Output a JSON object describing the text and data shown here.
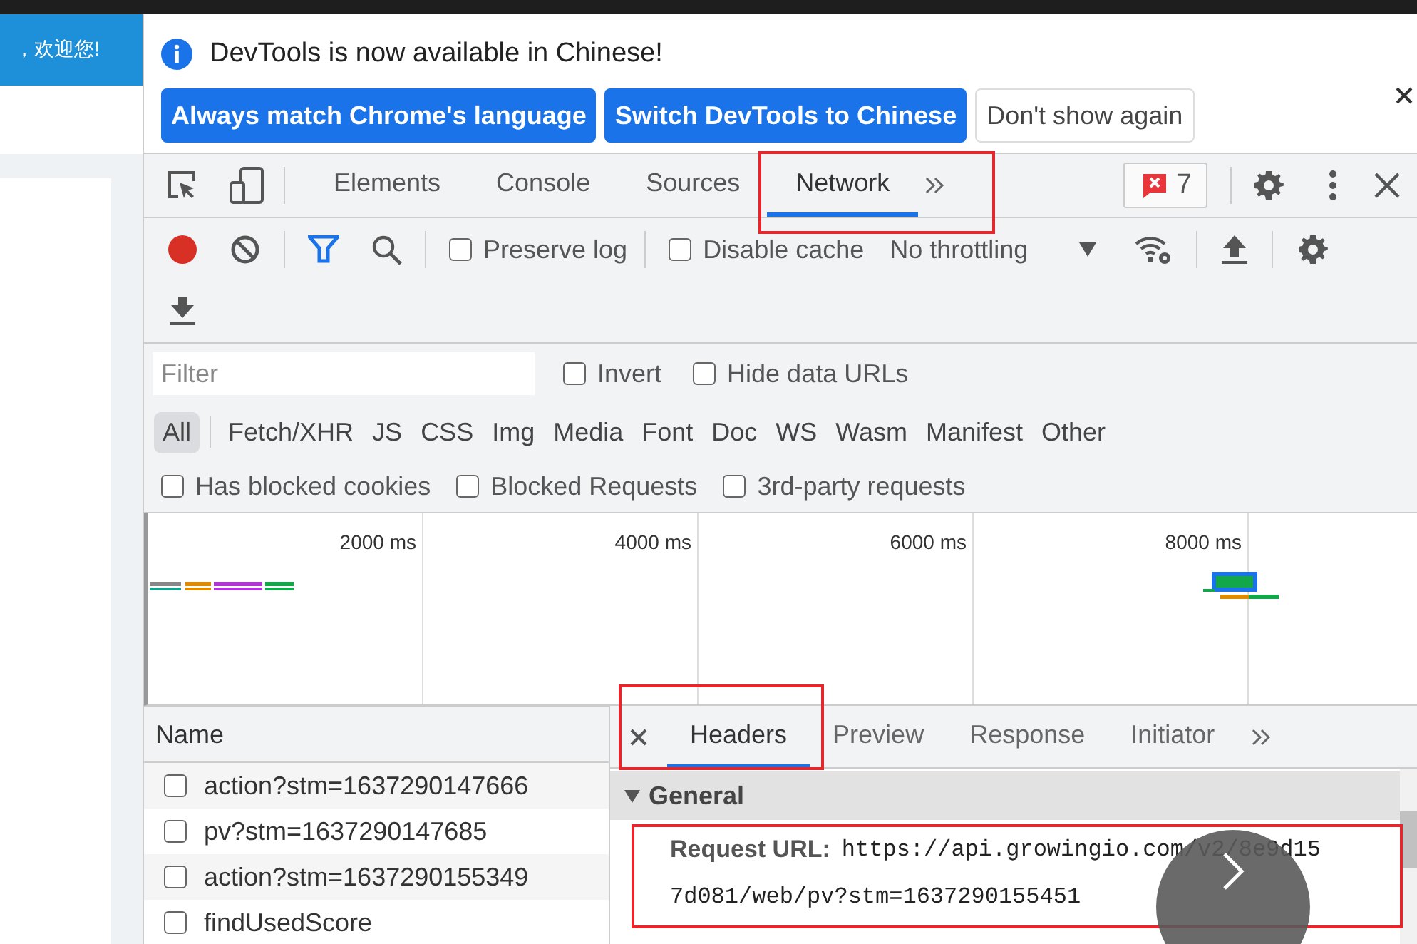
{
  "page_banner": {
    "text": "，欢迎您!"
  },
  "infobar": {
    "message": "DevTools is now available in Chinese!",
    "buttons": [
      {
        "label": "Always match Chrome's language",
        "kind": "primary"
      },
      {
        "label": "Switch DevTools to Chinese",
        "kind": "primary"
      },
      {
        "label": "Don't show again",
        "kind": "secondary"
      }
    ]
  },
  "panel_tabs": [
    {
      "label": "Elements",
      "selected": false
    },
    {
      "label": "Console",
      "selected": false
    },
    {
      "label": "Sources",
      "selected": false
    },
    {
      "label": "Network",
      "selected": true
    }
  ],
  "error_count": "7",
  "toolbar": {
    "recording": true,
    "checkboxes": [
      {
        "label": "Preserve log",
        "checked": false
      },
      {
        "label": "Disable cache",
        "checked": false
      }
    ],
    "throttling": "No throttling"
  },
  "filter": {
    "placeholder": "Filter",
    "options": [
      {
        "label": "Invert",
        "checked": false
      },
      {
        "label": "Hide data URLs",
        "checked": false
      }
    ]
  },
  "type_filters": [
    {
      "label": "All",
      "selected": true
    },
    {
      "label": "Fetch/XHR",
      "selected": false
    },
    {
      "label": "JS",
      "selected": false
    },
    {
      "label": "CSS",
      "selected": false
    },
    {
      "label": "Img",
      "selected": false
    },
    {
      "label": "Media",
      "selected": false
    },
    {
      "label": "Font",
      "selected": false
    },
    {
      "label": "Doc",
      "selected": false
    },
    {
      "label": "WS",
      "selected": false
    },
    {
      "label": "Wasm",
      "selected": false
    },
    {
      "label": "Manifest",
      "selected": false
    },
    {
      "label": "Other",
      "selected": false
    }
  ],
  "extra_filters": [
    {
      "label": "Has blocked cookies",
      "checked": false
    },
    {
      "label": "Blocked Requests",
      "checked": false
    },
    {
      "label": "3rd-party requests",
      "checked": false
    }
  ],
  "overview": {
    "ticks": [
      "2000 ms",
      "4000 ms",
      "6000 ms",
      "8000 ms"
    ]
  },
  "requests": {
    "column": "Name",
    "rows": [
      {
        "name": "action?stm=1637290147666",
        "checked": false
      },
      {
        "name": "pv?stm=1637290147685",
        "checked": false
      },
      {
        "name": "action?stm=1637290155349",
        "checked": false
      },
      {
        "name": "findUsedScore",
        "checked": false
      }
    ]
  },
  "details": {
    "tabs": [
      {
        "label": "Headers",
        "selected": true
      },
      {
        "label": "Preview",
        "selected": false
      },
      {
        "label": "Response",
        "selected": false
      },
      {
        "label": "Initiator",
        "selected": false
      }
    ],
    "section": {
      "title": "General",
      "expanded": true,
      "key": "Request URL:",
      "value_lines": [
        "https://api.growingio.com/v2/8e9d15",
        "7d081/web/pv?stm=1637290155451"
      ]
    }
  }
}
